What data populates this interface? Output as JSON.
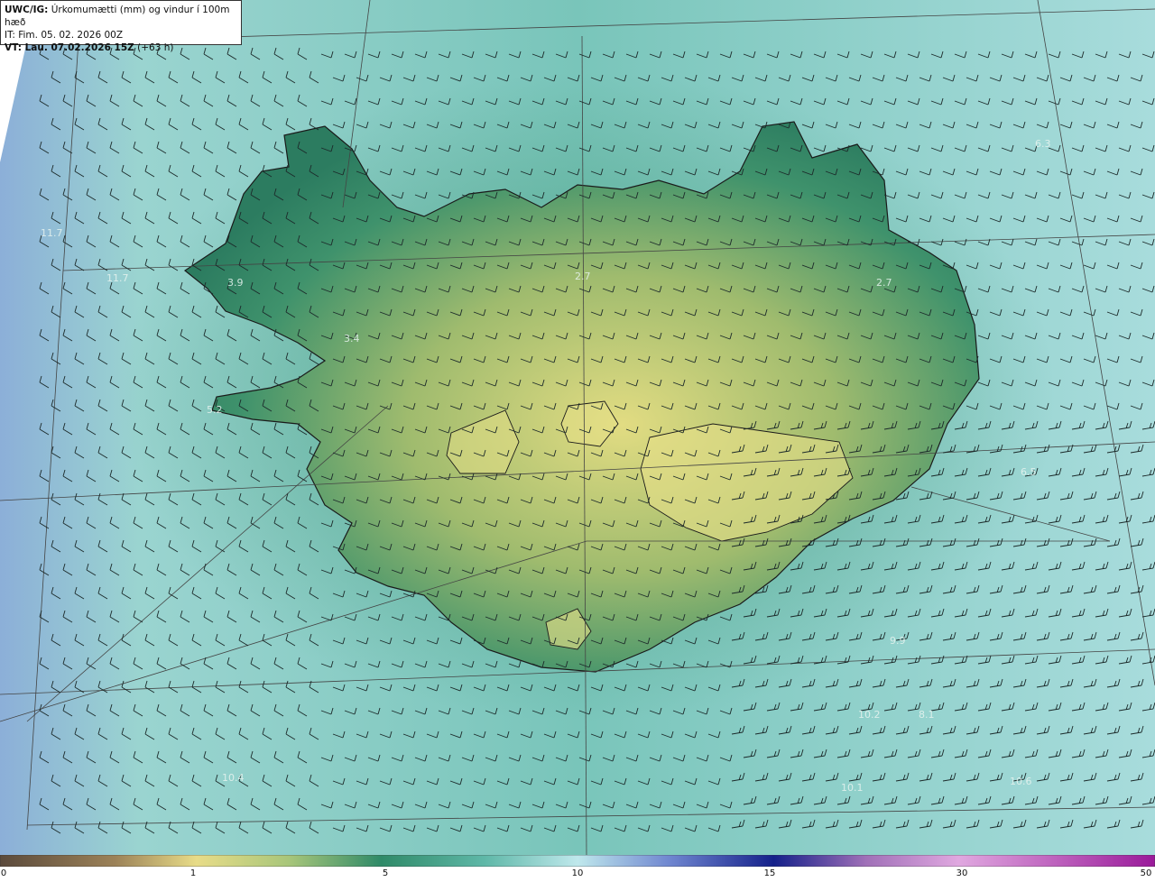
{
  "header": {
    "line1_bold": "UWC/IG:",
    "line1_rest": " Úrkomumætti (mm) og vindur í 100m hæð",
    "line2": "IT: Fim. 05. 02. 2026 00Z",
    "line3_bold": "VT: Lau. 07.02.2026 15Z",
    "line3_rest": " (+63 h)"
  },
  "map_labels": [
    "6.3",
    "11.7",
    "11.7",
    "3.9",
    "3.4",
    "5.2",
    "2.7",
    "2.7",
    "6.5",
    "9.9",
    "10.2",
    "8.1",
    "10.1",
    "10.4",
    "10.6"
  ],
  "colorbar": {
    "ticks": [
      "0",
      "1",
      "5",
      "10",
      "15",
      "30",
      "50"
    ],
    "colors": [
      "#5a4a3a",
      "#c9b070",
      "#f0e08a",
      "#3a8a6a",
      "#8ad0c8",
      "#c8ecf0",
      "#5060c0",
      "#102080",
      "#d080d0",
      "#a020a0"
    ]
  },
  "colors": {
    "ocean": "#8ccfc6",
    "land_low": "#2f8866",
    "land_high": "#d9d77e",
    "ocean_blue": "#8aaedc"
  }
}
